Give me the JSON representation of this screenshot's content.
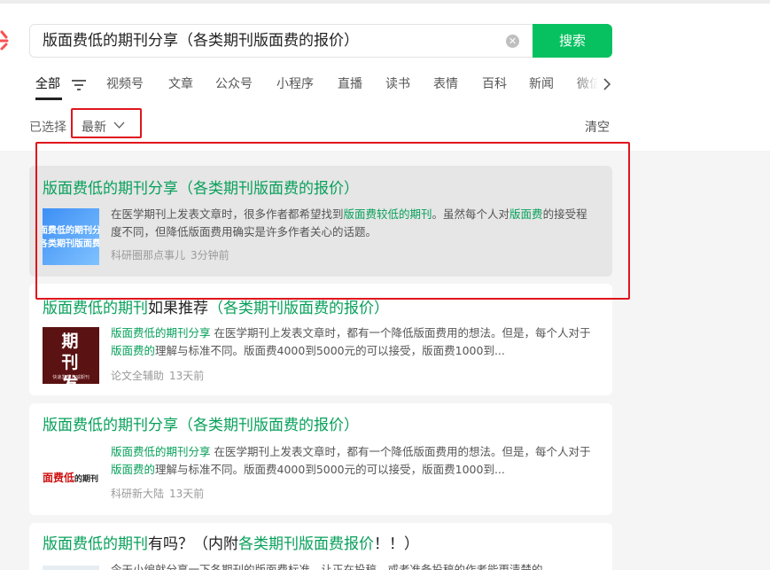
{
  "search": {
    "query": "版面费低的期刊分享（各类期刊版面费的报价）",
    "button": "搜索"
  },
  "tabs": [
    "全部",
    "视频号",
    "文章",
    "公众号",
    "小程序",
    "直播",
    "读书",
    "表情",
    "百科",
    "新闻",
    "微信"
  ],
  "filter": {
    "selected_label": "已选择",
    "sort": "最新",
    "clear": "清空"
  },
  "results": [
    {
      "title_parts": [
        "版面费低的期刊分享（各类期刊版面费的报价）"
      ],
      "text_parts": [
        "在医学期刊上发表文章时，很多作者都希望找到",
        "版面费较低的期刊",
        "。虽然每个人对",
        "版面费",
        "的接受程度不同，但降低版面费用确实是许多作者关心的话题。"
      ],
      "thumb_text": [
        "版面费低的期刊分享",
        "（各类期刊版面费的报价）"
      ],
      "source": "科研圈那点事儿",
      "time": "3分钟前"
    },
    {
      "title_parts": [
        "版面费低的期刊",
        "如果推荐",
        "（各类期刊版面费的报价）"
      ],
      "text_parts": [
        "版面费低的期刊分享",
        " 在医学期刊上发表文章时，都有一个降低版面费用的想法。但是，每个人对于",
        "版面费的",
        "理解与标准不同。版面费4000到5000元的可以接受，版面费1000到..."
      ],
      "thumb_text": [
        "期",
        "刊",
        "发",
        "表",
        "快速发表 权威期刊"
      ],
      "source": "论文全辅助",
      "time": "13天前"
    },
    {
      "title_parts": [
        "版面费低的期刊分享（各类期刊版面费的报价）"
      ],
      "text_parts": [
        "版面费低的期刊分享",
        " 在医学期刊上发表文章时，都有一个降低版面费用的想法。但是，每个人对于",
        "版面费的",
        "理解与标准不同。版面费4000到5000元的可以接受，版面费1000到..."
      ],
      "thumb_text": [
        "面费低",
        "的期刊"
      ],
      "source": "科研新大陆",
      "time": "13天前"
    },
    {
      "title_parts": [
        "版面费低的期刊",
        "有吗？（内附",
        "各类期刊版面费报价",
        "！！）"
      ],
      "text_parts": [
        "今天小编就分享一下各期刊的版面费标准，让正在投稿，或者准备投稿的作者能更清楚的..."
      ]
    }
  ],
  "colors": {
    "accent": "#07c160",
    "highlight_green": "#07a05a",
    "annotation_red": "#e0151c"
  }
}
